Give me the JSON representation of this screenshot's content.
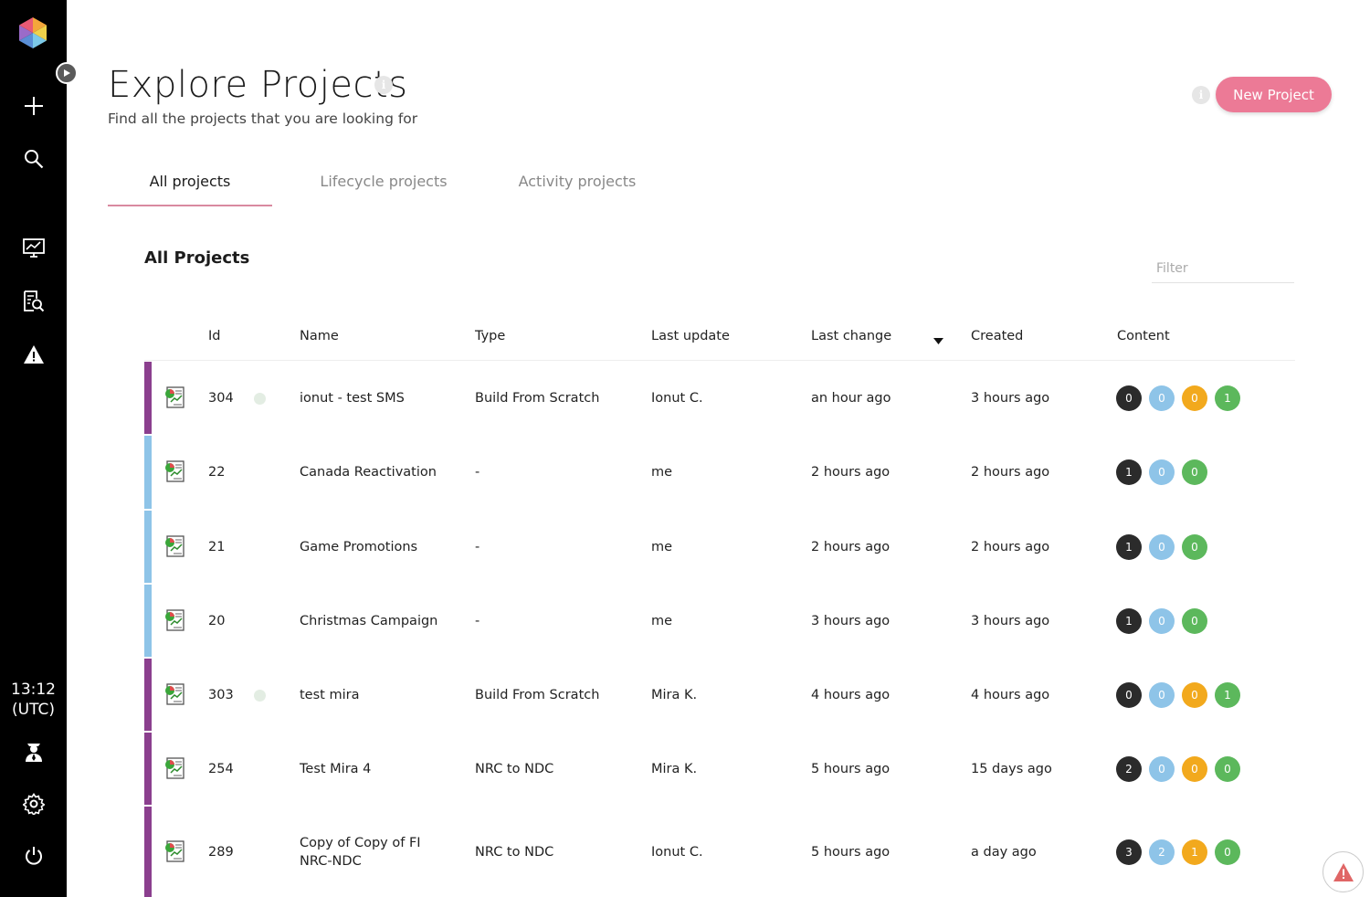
{
  "app": {
    "clock_time": "13:12",
    "clock_zone": "(UTC)"
  },
  "header": {
    "title": "Explore Projects",
    "subtitle": "Find all the projects that you are looking for",
    "new_project_label": "New Project"
  },
  "tabs": [
    {
      "label": "All projects",
      "active": true
    },
    {
      "label": "Lifecycle projects",
      "active": false
    },
    {
      "label": "Activity projects",
      "active": false
    }
  ],
  "section": {
    "title": "All Projects",
    "filter_placeholder": "Filter"
  },
  "table": {
    "columns": {
      "id": "Id",
      "name": "Name",
      "type": "Type",
      "last_update": "Last update",
      "last_change": "Last change",
      "created": "Created",
      "content": "Content"
    },
    "rows": [
      {
        "id": "304",
        "name_line1": "ionut - test SMS",
        "name_line2": "",
        "type": "Build From Scratch",
        "last_update": "Ionut C.",
        "last_change": "an hour ago",
        "created": "3 hours ago",
        "bar_color": "#8b3f8e",
        "status_dot": true,
        "content": [
          "0",
          "0",
          "0",
          "1"
        ]
      },
      {
        "id": "22",
        "name_line1": "Canada Reactivation",
        "name_line2": "",
        "type": "-",
        "last_update": "me",
        "last_change": "2 hours ago",
        "created": "2 hours ago",
        "bar_color": "#8ec4e8",
        "status_dot": false,
        "content": [
          "1",
          "0",
          "0"
        ]
      },
      {
        "id": "21",
        "name_line1": "Game Promotions",
        "name_line2": "",
        "type": "-",
        "last_update": "me",
        "last_change": "2 hours ago",
        "created": "2 hours ago",
        "bar_color": "#8ec4e8",
        "status_dot": false,
        "content": [
          "1",
          "0",
          "0"
        ]
      },
      {
        "id": "20",
        "name_line1": "Christmas Campaign",
        "name_line2": "",
        "type": "-",
        "last_update": "me",
        "last_change": "3 hours ago",
        "created": "3 hours ago",
        "bar_color": "#8ec4e8",
        "status_dot": false,
        "content": [
          "1",
          "0",
          "0"
        ]
      },
      {
        "id": "303",
        "name_line1": "test mira",
        "name_line2": "",
        "type": "Build From Scratch",
        "last_update": "Mira K.",
        "last_change": "4 hours ago",
        "created": "4 hours ago",
        "bar_color": "#8b3f8e",
        "status_dot": true,
        "content": [
          "0",
          "0",
          "0",
          "1"
        ]
      },
      {
        "id": "254",
        "name_line1": "Test Mira 4",
        "name_line2": "",
        "type": "NRC to NDC",
        "last_update": "Mira K.",
        "last_change": "5 hours ago",
        "created": "15 days ago",
        "bar_color": "#8b3f8e",
        "status_dot": false,
        "content": [
          "2",
          "0",
          "0",
          "0"
        ]
      },
      {
        "id": "289",
        "name_line1": "Copy of Copy of FI",
        "name_line2": "NRC-NDC",
        "type": "NRC to NDC",
        "last_update": "Ionut C.",
        "last_change": "5 hours ago",
        "created": "a day ago",
        "bar_color": "#8b3f8e",
        "status_dot": false,
        "content": [
          "3",
          "2",
          "1",
          "0"
        ]
      }
    ]
  },
  "colors": {
    "accent": "#ec7a96",
    "badge_dark": "#2b2b2b",
    "badge_blue": "#8ec4e8",
    "badge_orange": "#f2a91d",
    "badge_green": "#5cb85c"
  },
  "icons": [
    "logo-hexagon-icon",
    "play-icon",
    "plus-icon",
    "search-icon",
    "monitor-chart-icon",
    "document-search-icon",
    "warning-icon",
    "agent-icon",
    "gear-icon",
    "power-icon",
    "project-chart-icon",
    "sort-down-icon",
    "info-icon",
    "alert-triangle-icon"
  ]
}
